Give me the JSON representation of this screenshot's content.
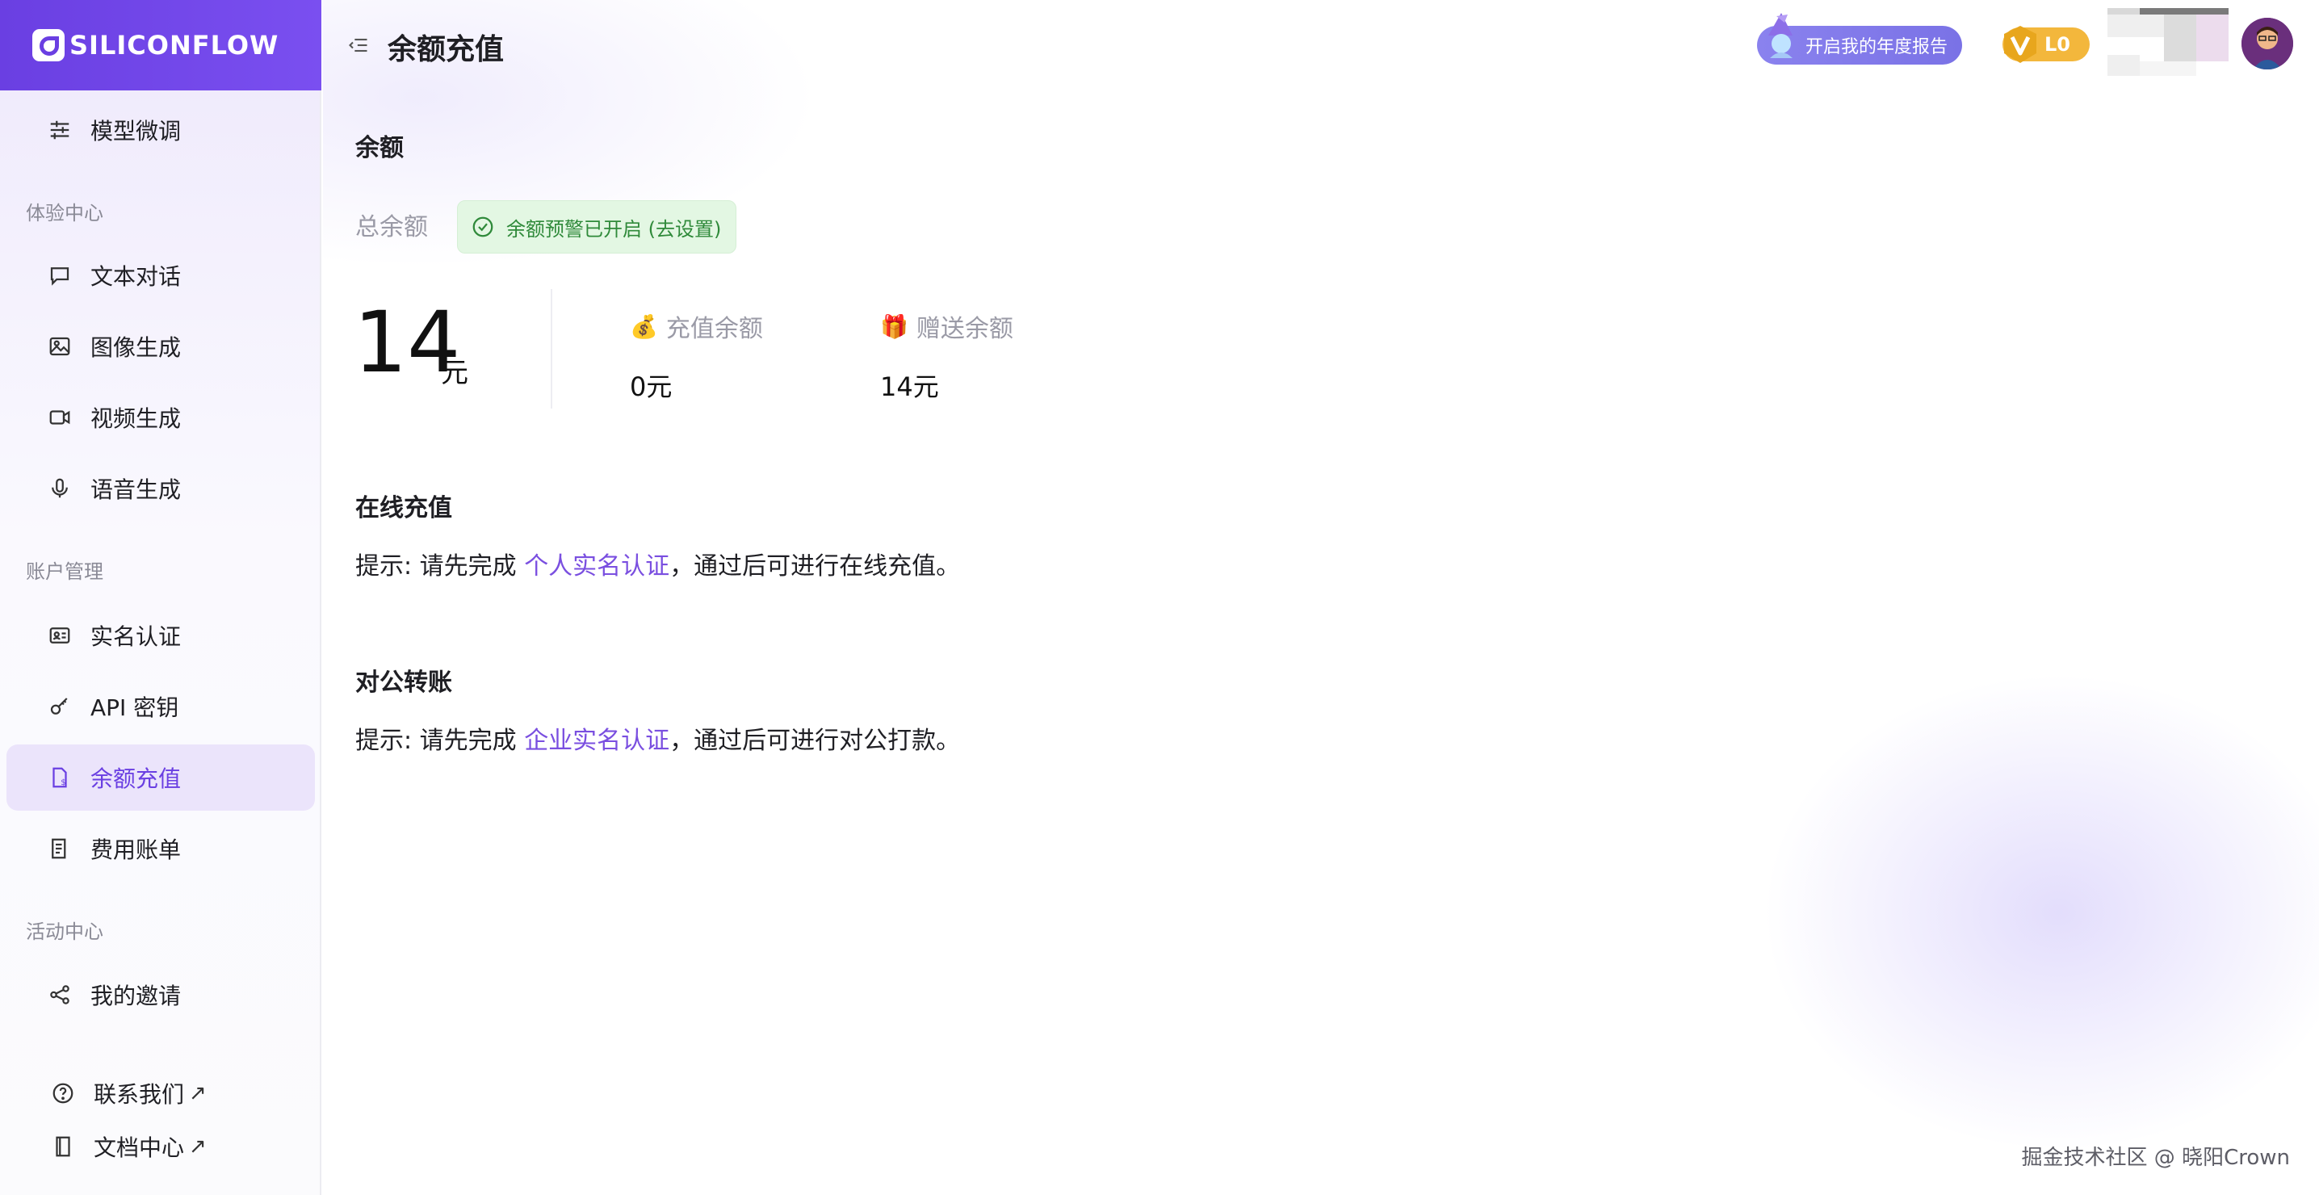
{
  "brand": {
    "name": "SILICONFLOW"
  },
  "sidebar": {
    "top_item": {
      "label": "模型微调",
      "icon": "sliders-icon"
    },
    "groups": [
      {
        "label": "体验中心",
        "items": [
          {
            "label": "文本对话",
            "icon": "chat-icon"
          },
          {
            "label": "图像生成",
            "icon": "image-icon"
          },
          {
            "label": "视频生成",
            "icon": "video-icon"
          },
          {
            "label": "语音生成",
            "icon": "microphone-icon"
          }
        ]
      },
      {
        "label": "账户管理",
        "items": [
          {
            "label": "实名认证",
            "icon": "id-card-icon"
          },
          {
            "label": "API 密钥",
            "icon": "key-icon"
          },
          {
            "label": "余额充值",
            "icon": "wallet-icon",
            "active": true
          },
          {
            "label": "费用账单",
            "icon": "bill-icon"
          }
        ]
      },
      {
        "label": "活动中心",
        "items": [
          {
            "label": "我的邀请",
            "icon": "share-icon"
          }
        ]
      }
    ],
    "footer_links": [
      {
        "label": "联系我们",
        "icon": "help-circle-icon",
        "ext": "↗"
      },
      {
        "label": "文档中心",
        "icon": "book-icon",
        "ext": "↗"
      }
    ]
  },
  "header": {
    "title": "余额充值",
    "annual_report_label": "开启我的年度报告",
    "level_label": "L0"
  },
  "balance": {
    "section_title": "余额",
    "total_label": "总余额",
    "alert_text": "余额预警已开启 (去设置)",
    "total_amount": "14",
    "total_unit": "元",
    "recharge_label": "充值余额",
    "recharge_emoji": "💰",
    "recharge_value": "0元",
    "gift_label": "赠送余额",
    "gift_emoji": "🎁",
    "gift_value": "14元"
  },
  "online": {
    "section_title": "在线充值",
    "hint_prefix": "提示: 请先完成 ",
    "hint_link": "个人实名认证",
    "hint_suffix": "，通过后可进行在线充值。"
  },
  "corporate": {
    "section_title": "对公转账",
    "hint_prefix": "提示: 请先完成 ",
    "hint_link": "企业实名认证",
    "hint_suffix": "，通过后可进行对公打款。"
  },
  "watermark": "掘金技术社区 @ 晓阳Crown",
  "colors": {
    "brand": "#6a3fe2",
    "link": "#7a4fe0",
    "active_bg": "#ebe4fb",
    "alert_bg": "#e3f7e3",
    "alert_text": "#2f8a3a",
    "level_badge": "#f3b73c"
  }
}
